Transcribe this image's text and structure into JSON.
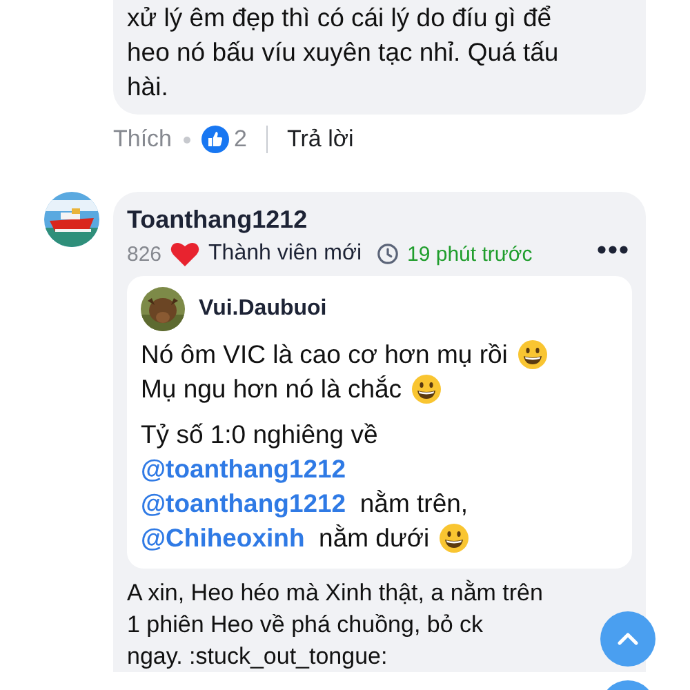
{
  "comments": [
    {
      "kind": "tail",
      "lines": [
        "xử lý êm đẹp thì có cái lý do đíu gì để",
        "heo nó bấu víu xuyên tạc nhỉ. Quá tấu",
        "hài."
      ],
      "actions": {
        "like": "Thích",
        "like_count": "2",
        "reply": "Trả lời"
      }
    },
    {
      "kind": "full",
      "author": "Toanthang1212",
      "points": "826",
      "rank": "Thành viên mới",
      "time": "19 phút trước",
      "quote": {
        "author": "Vui.Daubuoi",
        "paragraphs": [
          [
            [
              {
                "kind": "text",
                "text": "Nó ôm VIC là cao cơ hơn mụ rồi "
              },
              {
                "kind": "emoji"
              }
            ],
            [
              {
                "kind": "text",
                "text": "Mụ ngu hơn nó là chắc "
              },
              {
                "kind": "emoji"
              }
            ]
          ],
          [
            [
              {
                "kind": "text",
                "text": "Tỷ số 1:0 nghiêng về"
              }
            ],
            [
              {
                "kind": "mention",
                "text": "@toanthang1212"
              }
            ],
            [
              {
                "kind": "mention",
                "text": "@toanthang1212"
              },
              {
                "kind": "text",
                "text": "  nằm trên,"
              }
            ],
            [
              {
                "kind": "mention",
                "text": "@Chiheoxinh"
              },
              {
                "kind": "text",
                "text": "  nằm dưới "
              },
              {
                "kind": "emoji"
              }
            ]
          ]
        ]
      },
      "lines": [
        "A xin, Heo héo mà Xinh thật, a nằm trên",
        "1 phiên Heo về phá chuồng, bỏ ck",
        "ngay. :stuck_out_tongue:"
      ]
    }
  ]
}
